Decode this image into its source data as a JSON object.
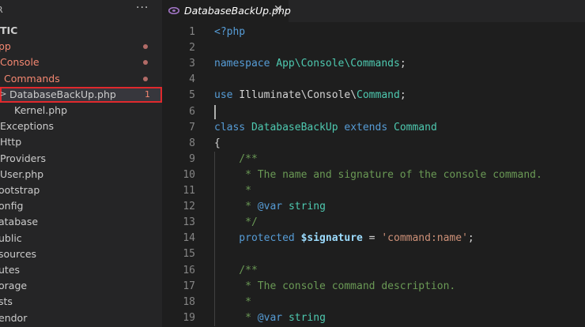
{
  "sidebar": {
    "title": "R",
    "more_label": "···",
    "items": [
      {
        "label": "TIC",
        "indent": 0,
        "err": false,
        "bold": true
      },
      {
        "label": "pp",
        "indent": -2,
        "err": true,
        "dot": true
      },
      {
        "label": "Console",
        "indent": 0,
        "err": true,
        "dot": true
      },
      {
        "label": "Commands",
        "indent": 5,
        "err": true,
        "dot": true
      },
      {
        "label": "DatabaseBackUp.php",
        "indent": 12,
        "err": false,
        "selected": true,
        "badge": "1"
      },
      {
        "label": "Kernel.php",
        "indent": 18,
        "err": false
      },
      {
        "label": "Exceptions",
        "indent": 0,
        "err": false
      },
      {
        "label": "Http",
        "indent": 0,
        "err": false
      },
      {
        "label": "Providers",
        "indent": 0,
        "err": false
      },
      {
        "label": "User.php",
        "indent": 0,
        "err": false
      },
      {
        "label": "ootstrap",
        "indent": -2,
        "err": false
      },
      {
        "label": "onfig",
        "indent": -2,
        "err": false
      },
      {
        "label": "atabase",
        "indent": -2,
        "err": false
      },
      {
        "label": "ublic",
        "indent": -2,
        "err": false
      },
      {
        "label": "sources",
        "indent": -2,
        "err": false
      },
      {
        "label": "utes",
        "indent": -2,
        "err": false
      },
      {
        "label": "orage",
        "indent": -2,
        "err": false
      },
      {
        "label": "sts",
        "indent": -2,
        "err": false
      },
      {
        "label": "endor",
        "indent": -2,
        "err": false
      }
    ]
  },
  "tab": {
    "label": "DatabaseBackUp.php",
    "close": "✕",
    "icon": "php-file-icon"
  },
  "editor": {
    "lines": [
      {
        "n": "1",
        "tokens": [
          {
            "t": "<?php",
            "c": "k"
          }
        ]
      },
      {
        "n": "2",
        "tokens": []
      },
      {
        "n": "3",
        "tokens": [
          {
            "t": "namespace ",
            "c": "k"
          },
          {
            "t": "App\\Console\\Commands",
            "c": "t"
          },
          {
            "t": ";",
            "c": "p"
          }
        ]
      },
      {
        "n": "4",
        "tokens": []
      },
      {
        "n": "5",
        "tokens": [
          {
            "t": "use ",
            "c": "k"
          },
          {
            "t": "Illuminate\\Console\\",
            "c": "w"
          },
          {
            "t": "Command",
            "c": "t"
          },
          {
            "t": ";",
            "c": "p"
          }
        ]
      },
      {
        "n": "6",
        "tokens": [],
        "cursor": true
      },
      {
        "n": "7",
        "tokens": [
          {
            "t": "class ",
            "c": "k"
          },
          {
            "t": "DatabaseBackUp ",
            "c": "t"
          },
          {
            "t": "extends ",
            "c": "k"
          },
          {
            "t": "Command",
            "c": "t"
          }
        ]
      },
      {
        "n": "8",
        "tokens": [
          {
            "t": "{",
            "c": "p"
          }
        ]
      },
      {
        "n": "9",
        "tokens": [
          {
            "t": "    /**",
            "c": "c"
          }
        ]
      },
      {
        "n": "10",
        "tokens": [
          {
            "t": "     * The name and signature of the console command.",
            "c": "c"
          }
        ]
      },
      {
        "n": "11",
        "tokens": [
          {
            "t": "     *",
            "c": "c"
          }
        ]
      },
      {
        "n": "12",
        "tokens": [
          {
            "t": "     * ",
            "c": "c"
          },
          {
            "t": "@var ",
            "c": "k"
          },
          {
            "t": "string",
            "c": "t"
          }
        ]
      },
      {
        "n": "13",
        "tokens": [
          {
            "t": "     */",
            "c": "c"
          }
        ]
      },
      {
        "n": "14",
        "tokens": [
          {
            "t": "    protected ",
            "c": "k"
          },
          {
            "t": "$signature",
            "c": "v"
          },
          {
            "t": " = ",
            "c": "p"
          },
          {
            "t": "'command:name'",
            "c": "s"
          },
          {
            "t": ";",
            "c": "p"
          }
        ]
      },
      {
        "n": "15",
        "tokens": []
      },
      {
        "n": "16",
        "tokens": [
          {
            "t": "    /**",
            "c": "c"
          }
        ]
      },
      {
        "n": "17",
        "tokens": [
          {
            "t": "     * The console command description.",
            "c": "c"
          }
        ]
      },
      {
        "n": "18",
        "tokens": [
          {
            "t": "     *",
            "c": "c"
          }
        ]
      },
      {
        "n": "19",
        "tokens": [
          {
            "t": "     * ",
            "c": "c"
          },
          {
            "t": "@var ",
            "c": "k"
          },
          {
            "t": "string",
            "c": "t"
          }
        ]
      }
    ]
  }
}
